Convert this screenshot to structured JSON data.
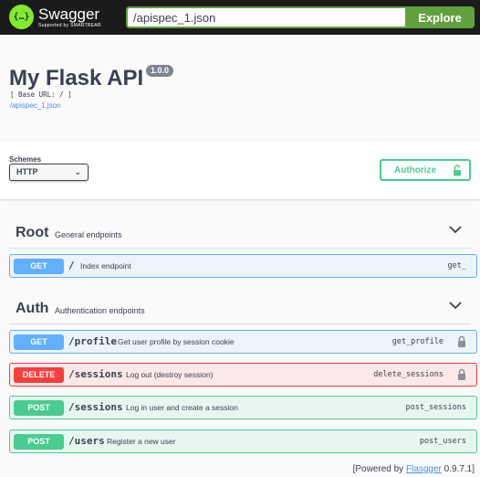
{
  "topbar": {
    "logo_text": "Swagger",
    "logo_sub": "Supported by SMARTBEAR",
    "url_value": "/apispec_1.json",
    "explore_label": "Explore"
  },
  "info": {
    "title": "My Flask API",
    "version": "1.0.0",
    "base_url": "[ Base URL: / ]",
    "spec_link": "/apispec_1.json"
  },
  "schemes": {
    "label": "Schemes",
    "selected": "HTTP",
    "authorize_label": "Authorize"
  },
  "tags": [
    {
      "name": "Root",
      "description": "General endpoints",
      "operations": [
        {
          "method": "GET",
          "path": "/",
          "summary": "Index endpoint",
          "operation_id": "get_",
          "locked": false
        }
      ]
    },
    {
      "name": "Auth",
      "description": "Authentication endpoints",
      "operations": [
        {
          "method": "GET",
          "path": "/profile",
          "summary": "Get user profile by session cookie",
          "operation_id": "get_profile",
          "locked": true
        },
        {
          "method": "DELETE",
          "path": "/sessions",
          "summary": "Log out (destroy session)",
          "operation_id": "delete_sessions",
          "locked": true
        },
        {
          "method": "POST",
          "path": "/sessions",
          "summary": "Log in user and create a session",
          "operation_id": "post_sessions",
          "locked": false
        },
        {
          "method": "POST",
          "path": "/users",
          "summary": "Register a new user",
          "operation_id": "post_users",
          "locked": false
        }
      ]
    }
  ],
  "footer": {
    "prefix": "[Powered by ",
    "link": "Flasgger",
    "suffix": " 0.9.7.1]"
  },
  "colors": {
    "get": "#61affe",
    "delete": "#f93e3e",
    "post": "#49cc90",
    "explore": "#62a03f"
  }
}
